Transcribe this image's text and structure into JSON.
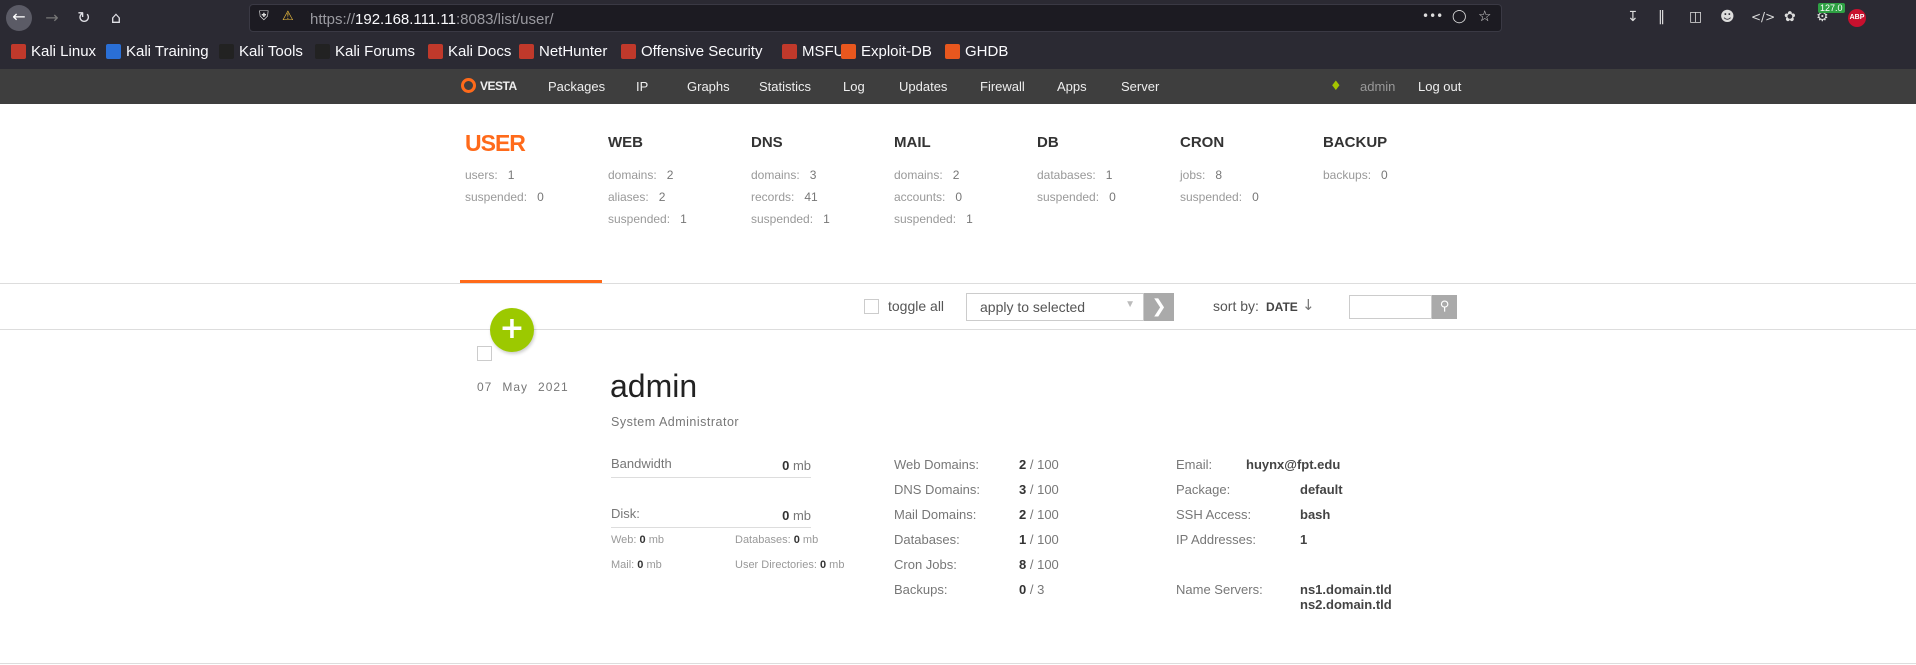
{
  "browser": {
    "url_prefix": "https://",
    "url_host": "192.168.111.11",
    "url_rest": ":8083/list/user/",
    "counter_badge": "127.0",
    "abp_badge": "ABP",
    "icons": [
      "back-icon",
      "forward-icon",
      "reload-icon",
      "home-icon",
      "shield-icon",
      "lock-warning-icon",
      "more-icon",
      "pocket-icon",
      "star-icon",
      "download-icon",
      "library-icon",
      "sidebar-icon",
      "account-icon",
      "devtools-icon",
      "cookie-icon",
      "extension-icon",
      "adblock-icon"
    ]
  },
  "bookmarks": [
    {
      "label": "Kali Linux",
      "color": "#c0392b"
    },
    {
      "label": "Kali Training",
      "color": "#2a6fd6"
    },
    {
      "label": "Kali Tools",
      "color": "#222222"
    },
    {
      "label": "Kali Forums",
      "color": "#222222"
    },
    {
      "label": "Kali Docs",
      "color": "#c0392b"
    },
    {
      "label": "NetHunter",
      "color": "#c0392b"
    },
    {
      "label": "Offensive Security",
      "color": "#c0392b"
    },
    {
      "label": "MSFU",
      "color": "#c0392b"
    },
    {
      "label": "Exploit-DB",
      "color": "#e8571e"
    },
    {
      "label": "GHDB",
      "color": "#e8571e"
    }
  ],
  "topnav": {
    "logo": "VESTA",
    "items": [
      "Packages",
      "IP",
      "Graphs",
      "Statistics",
      "Log",
      "Updates",
      "Firewall",
      "Apps",
      "Server"
    ],
    "user": "admin",
    "logout": "Log out"
  },
  "stats": [
    {
      "title": "USER",
      "rows": [
        [
          "users:",
          "1"
        ],
        [
          "suspended:",
          "0"
        ]
      ]
    },
    {
      "title": "WEB",
      "rows": [
        [
          "domains:",
          "2"
        ],
        [
          "aliases:",
          "2"
        ],
        [
          "suspended:",
          "1"
        ]
      ]
    },
    {
      "title": "DNS",
      "rows": [
        [
          "domains:",
          "3"
        ],
        [
          "records:",
          "41"
        ],
        [
          "suspended:",
          "1"
        ]
      ]
    },
    {
      "title": "MAIL",
      "rows": [
        [
          "domains:",
          "2"
        ],
        [
          "accounts:",
          "0"
        ],
        [
          "suspended:",
          "1"
        ]
      ]
    },
    {
      "title": "DB",
      "rows": [
        [
          "databases:",
          "1"
        ],
        [
          "suspended:",
          "0"
        ]
      ]
    },
    {
      "title": "CRON",
      "rows": [
        [
          "jobs:",
          "8"
        ],
        [
          "suspended:",
          "0"
        ]
      ]
    },
    {
      "title": "BACKUP",
      "rows": [
        [
          "backups:",
          "0"
        ]
      ]
    }
  ],
  "toolbar": {
    "toggle_all": "toggle all",
    "apply_selected": "apply to selected",
    "sort_by": "sort by:",
    "sort_value": "DATE",
    "search_value": ""
  },
  "user": {
    "date_day": "07",
    "date_month": "May",
    "date_year": "2021",
    "name": "admin",
    "role": "System Administrator",
    "bandwidth_label": "Bandwidth",
    "bandwidth_value": "0",
    "disk_label": "Disk:",
    "disk_value": "0",
    "unit": "mb",
    "disk_breakdown": [
      [
        "Web:",
        "0"
      ],
      [
        "Databases:",
        "0"
      ],
      [
        "Mail:",
        "0"
      ],
      [
        "User Directories:",
        "0"
      ]
    ],
    "limits": [
      [
        "Web Domains:",
        "2",
        "/ 100"
      ],
      [
        "DNS Domains:",
        "3",
        "/ 100"
      ],
      [
        "Mail Domains:",
        "2",
        "/ 100"
      ],
      [
        "Databases:",
        "1",
        "/ 100"
      ],
      [
        "Cron Jobs:",
        "8",
        "/ 100"
      ],
      [
        "Backups:",
        "0",
        "/ 3"
      ]
    ],
    "email_label": "Email:",
    "email_value": "huynx@fpt.edu",
    "package_label": "Package:",
    "package_value": "default",
    "ssh_label": "SSH Access:",
    "ssh_value": "bash",
    "ip_label": "IP Addresses:",
    "ip_value": "1",
    "ns_label": "Name Servers:",
    "ns1": "ns1.domain.tld",
    "ns2": "ns2.domain.tld"
  },
  "colors": {
    "accent": "#ff6a1a",
    "add_button": "#9cc900"
  }
}
